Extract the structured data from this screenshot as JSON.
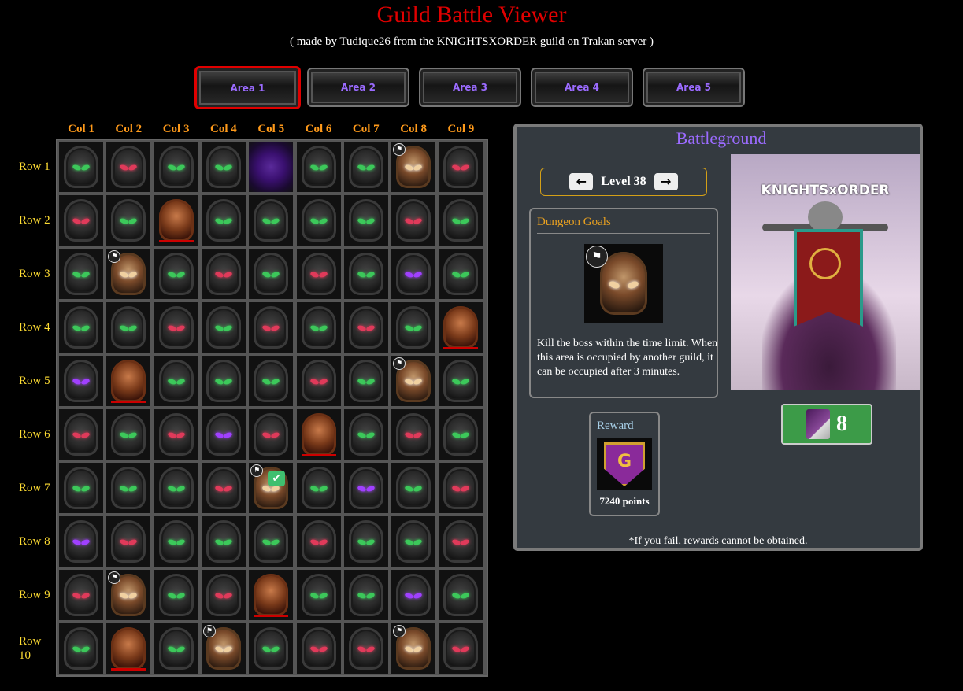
{
  "header": {
    "title": "Guild Battle Viewer",
    "subtitle": "( made by Tudique26 from the KNIGHTSXORDER guild on Trakan server )"
  },
  "area_tabs": [
    "Area 1",
    "Area 2",
    "Area 3",
    "Area 4",
    "Area 5"
  ],
  "active_area": "Area 1",
  "grid": {
    "columns": [
      "Col 1",
      "Col 2",
      "Col 3",
      "Col 4",
      "Col 5",
      "Col 6",
      "Col 7",
      "Col 8",
      "Col 9"
    ],
    "rows": [
      "Row 1",
      "Row 2",
      "Row 3",
      "Row 4",
      "Row 5",
      "Row 6",
      "Row 7",
      "Row 8",
      "Row 9",
      "Row 10"
    ],
    "cells": [
      [
        "green",
        "red",
        "green",
        "green",
        "portal",
        "green",
        "green",
        "boss-flag",
        "red"
      ],
      [
        "red",
        "green",
        "elite",
        "green",
        "green",
        "green",
        "green",
        "red",
        "green"
      ],
      [
        "green",
        "boss-flag",
        "green",
        "red",
        "green",
        "red",
        "green",
        "purple",
        "green"
      ],
      [
        "green",
        "green",
        "red",
        "green",
        "red",
        "green",
        "red",
        "green",
        "elite"
      ],
      [
        "purple",
        "elite",
        "green",
        "green",
        "green",
        "red",
        "green",
        "boss-flag",
        "green"
      ],
      [
        "red",
        "green",
        "red",
        "purple",
        "red",
        "elite",
        "green",
        "red",
        "green"
      ],
      [
        "green",
        "green",
        "green",
        "red",
        "boss-flag-check",
        "green",
        "purple",
        "green",
        "red"
      ],
      [
        "purple",
        "red",
        "green",
        "green",
        "green",
        "red",
        "green",
        "green",
        "red"
      ],
      [
        "red",
        "boss-flag",
        "green",
        "red",
        "elite",
        "green",
        "green",
        "purple",
        "green"
      ],
      [
        "green",
        "elite",
        "green",
        "boss-flag",
        "green",
        "red",
        "red",
        "boss-flag",
        "red"
      ]
    ],
    "eye_colors": {
      "green": "#3cc85a",
      "red": "#e03a5a",
      "purple": "#a040ff"
    }
  },
  "panel": {
    "title": "Battleground",
    "level_label": "Level 38",
    "prev_icon": "left-arrow-icon",
    "next_icon": "right-arrow-icon",
    "goals_title": "Dungeon Goals",
    "goal_text": "Kill the boss within the time limit. When this area is occupied by another guild, it can be occupied after 3 minutes.",
    "portrait_title": "KNIGHTSxORDER",
    "count": "8",
    "reward_title": "Reward",
    "reward_icon_letter": "G",
    "reward_points": "7240 points",
    "footnote": "*If you fail, rewards cannot be obtained."
  }
}
